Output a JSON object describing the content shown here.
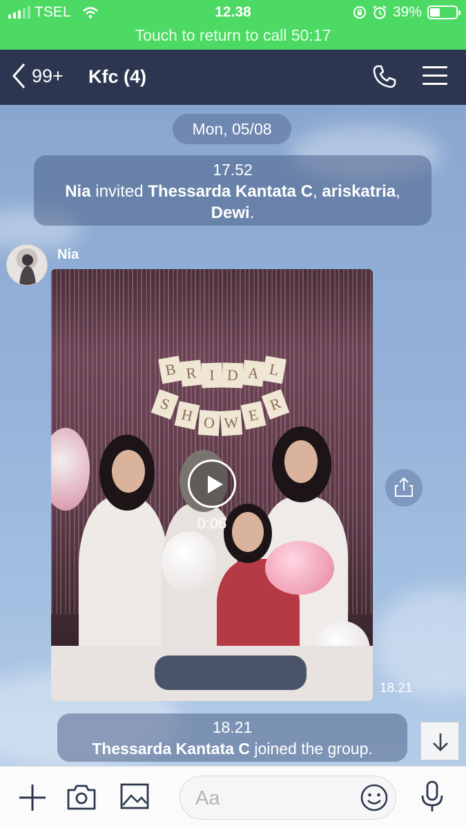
{
  "status_bar": {
    "carrier": "TSEL",
    "time": "12.38",
    "battery_percent": "39%",
    "battery_level": 0.39,
    "call_banner": "Touch to return to call 50:17"
  },
  "header": {
    "back_count": "99+",
    "title": "Kfc (4)"
  },
  "chat": {
    "date": "Mon, 05/08",
    "messages": [
      {
        "type": "system",
        "time": "17.52",
        "parts": [
          {
            "text": "Nia",
            "bold": true
          },
          {
            "text": " invited ",
            "bold": false
          },
          {
            "text": "Thessarda Kantata C",
            "bold": true
          },
          {
            "text": ", ",
            "bold": false
          },
          {
            "text": "ariskatria",
            "bold": true
          },
          {
            "text": ", ",
            "bold": false
          },
          {
            "text": "Dewi",
            "bold": true
          },
          {
            "text": ".",
            "bold": false
          }
        ]
      },
      {
        "type": "video",
        "sender": "Nia",
        "duration": "0:06",
        "time": "18.21",
        "banner_top": [
          "B",
          "R",
          "I",
          "D",
          "A",
          "L"
        ],
        "banner_bottom": [
          "S",
          "H",
          "O",
          "W",
          "E",
          "R"
        ]
      },
      {
        "type": "system",
        "time": "18.21",
        "parts": [
          {
            "text": "Thessarda Kantata C",
            "bold": true
          },
          {
            "text": " joined the group.",
            "bold": false
          }
        ]
      }
    ]
  },
  "input": {
    "placeholder": "Aa"
  },
  "icons": {
    "back": "chevron-left-icon",
    "call": "phone-icon",
    "menu": "hamburger-menu-icon",
    "share": "share-icon",
    "scroll_down": "arrow-down-icon",
    "add": "plus-icon",
    "camera": "camera-icon",
    "gallery": "image-icon",
    "emoji": "emoji-icon",
    "mic": "microphone-icon"
  },
  "colors": {
    "status_bar": "#4cd964",
    "header": "#2c3650",
    "chat_background": "#8faed6",
    "toolbar_icons": "#2c3650"
  }
}
